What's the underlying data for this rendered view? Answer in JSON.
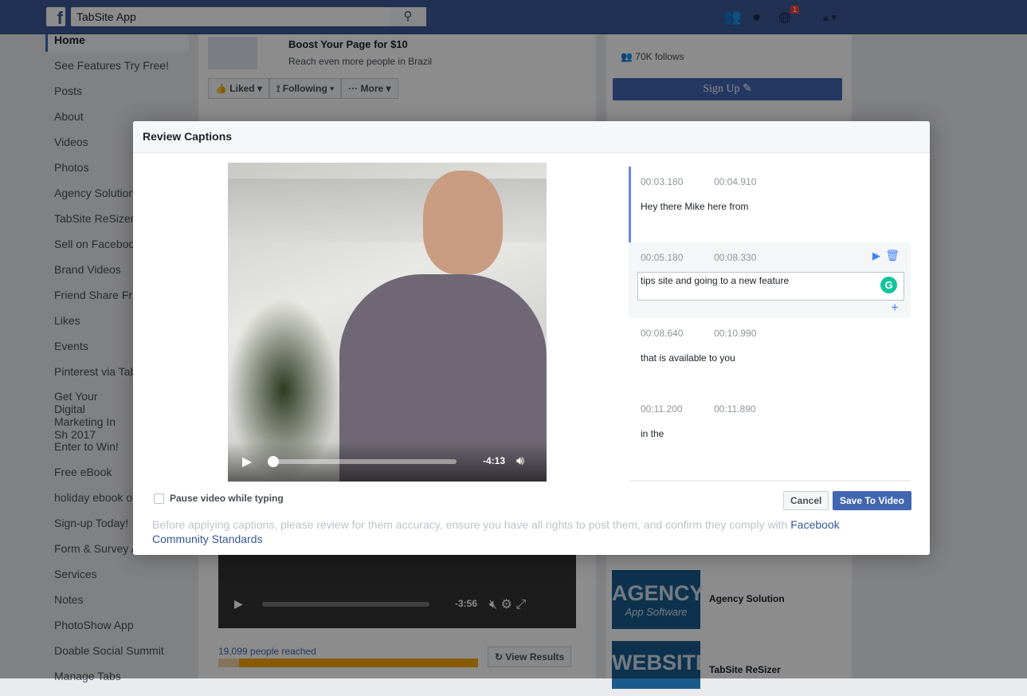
{
  "topbar": {
    "search_value": "TabSite App",
    "notification_count": "1"
  },
  "sidebar": {
    "items": [
      "Home",
      "See Features Try Free!",
      "Posts",
      "About",
      "Videos",
      "Photos",
      "Agency Solution",
      "TabSite ReSizer",
      "Sell on Facebook",
      "Brand Videos",
      "Friend Share Fr",
      "Likes",
      "Events",
      "Pinterest via Tab",
      "Get Your Digital Marketing In Sh 2017",
      "Enter to Win!",
      "Free eBook",
      "holiday ebook o",
      "Sign-up Today!",
      "Form & Survey App",
      "Services",
      "Notes",
      "PhotoShow App",
      "Doable Social Summit",
      "Manage Tabs"
    ]
  },
  "main": {
    "boost_title": "Boost Your Page for $10",
    "boost_sub": "Reach even more people in Brazil",
    "liked": "Liked",
    "following": "Following",
    "more": "More",
    "video_time": "-3:56",
    "reached": "19,099 people reached",
    "reach_progress": 0.08,
    "view_results": "View Results"
  },
  "right": {
    "follows": "70K follows",
    "signup": "Sign Up",
    "apps": [
      {
        "name": "Agency Solution",
        "logo": "AGENCY",
        "logo_sub": "App Software"
      },
      {
        "name": "TabSite ReSizer",
        "logo": "WEBSITE",
        "logo_sub": ""
      }
    ]
  },
  "modal": {
    "title": "Review Captions",
    "video_time": "-4:13",
    "captions": [
      {
        "start": "00:03.180",
        "end": "00:04.910",
        "text": "Hey there Mike here from"
      },
      {
        "start": "00:05.180",
        "end": "00:08.330",
        "text": "tips site and going to a new feature"
      },
      {
        "start": "00:08.640",
        "end": "00:10.990",
        "text": "that is available to you"
      },
      {
        "start": "00:11.200",
        "end": "00:11.890",
        "text": "in the"
      }
    ],
    "pause_label": "Pause video while typing",
    "cancel": "Cancel",
    "save": "Save To Video",
    "disclaimer": "Before applying captions, please review for them accuracy, ensure you have all rights to post them, and confirm they comply with",
    "link": "Facebook Community Standards"
  }
}
